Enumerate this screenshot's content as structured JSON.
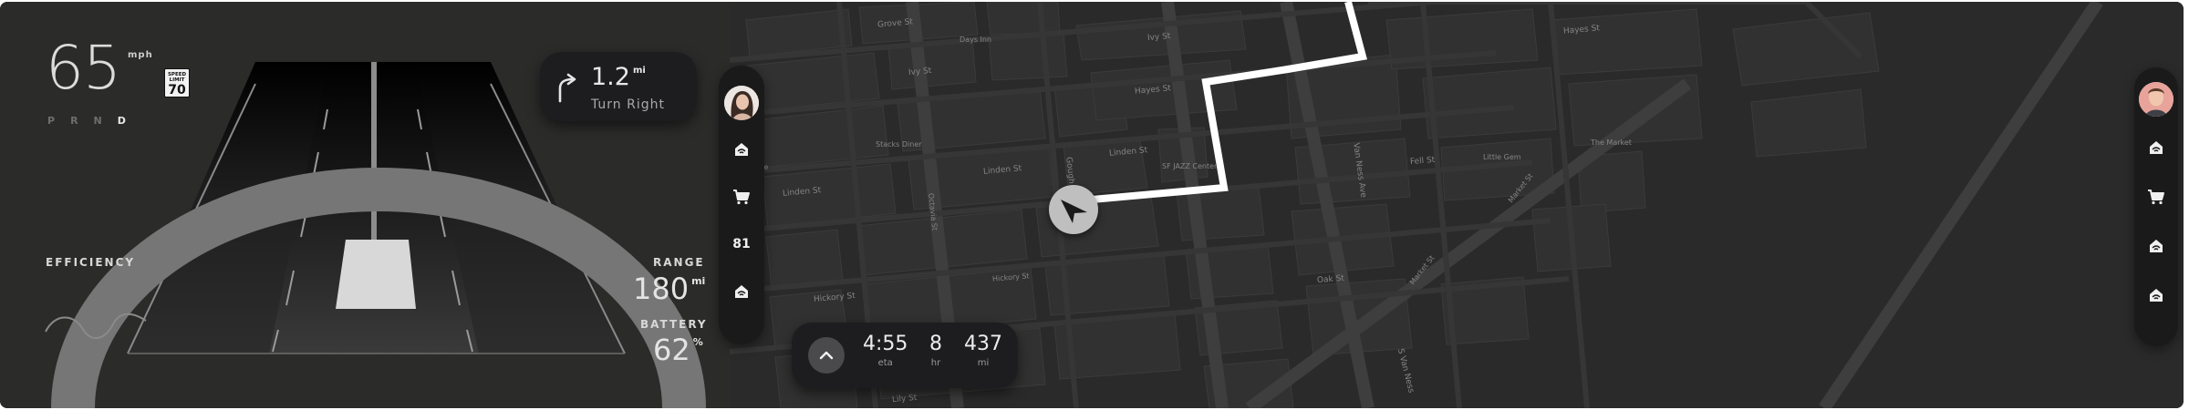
{
  "speed": {
    "value": "65",
    "unit": "mph"
  },
  "speed_limit": {
    "label_top": "SPEED",
    "label_bottom": "LIMIT",
    "value": "70"
  },
  "gears": {
    "p": "P",
    "r": "R",
    "n": "N",
    "d": "D",
    "active": "D"
  },
  "efficiency": {
    "label": "EFFICIENCY"
  },
  "range": {
    "label": "RANGE",
    "value": "180",
    "unit": "mi"
  },
  "battery": {
    "label": "BATTERY",
    "value": "62",
    "unit": "%"
  },
  "turn": {
    "distance": "1.2",
    "unit": "mi",
    "instruction": "Turn Right",
    "icon": "turn-right-arrow-icon"
  },
  "left_dock": {
    "items": [
      {
        "type": "avatar"
      },
      {
        "type": "icon",
        "icon": "garage-icon"
      },
      {
        "type": "icon",
        "icon": "cart-icon"
      },
      {
        "type": "badge",
        "label": "81"
      },
      {
        "type": "icon",
        "icon": "garage-icon"
      }
    ]
  },
  "right_dock": {
    "items": [
      {
        "type": "avatar"
      },
      {
        "type": "icon",
        "icon": "garage-icon"
      },
      {
        "type": "icon",
        "icon": "cart-icon"
      },
      {
        "type": "icon",
        "icon": "garage-icon"
      },
      {
        "type": "icon",
        "icon": "garage-icon"
      }
    ]
  },
  "trip": {
    "eta": {
      "value": "4:55",
      "label": "eta"
    },
    "hr": {
      "value": "8",
      "label": "hr"
    },
    "mi": {
      "value": "437",
      "label": "mi"
    }
  },
  "map": {
    "streets": {
      "grove": "Grove St",
      "days_inn": "Days Inn",
      "ivy_1": "Ivy St",
      "ivy_2": "Ivy St",
      "hayes_1": "Hayes St",
      "hayes_2": "Hayes St",
      "linden_1": "Linden St",
      "linden_2": "Linden St",
      "linden_3": "Linden St",
      "stacks": "Stacks Diner",
      "che": "che",
      "octavia": "Octavia St",
      "gough": "Gough",
      "sf_jazz": "SF JAZZ Center",
      "van_ness": "Van Ness Ave",
      "fell": "Fell St",
      "little_gem": "Little Gem",
      "the_market": "The Market",
      "hickory_1": "Hickory St",
      "hickory_2": "Hickory St",
      "oak": "Oak St",
      "market_1": "Market St",
      "market_2": "Market St",
      "lily": "Lily St",
      "s_van_ness": "S Van Ness"
    }
  },
  "colors": {
    "background": "#292928",
    "card": "#1d1d1f",
    "route": "#ffffff",
    "text": "#e8e8e8"
  }
}
